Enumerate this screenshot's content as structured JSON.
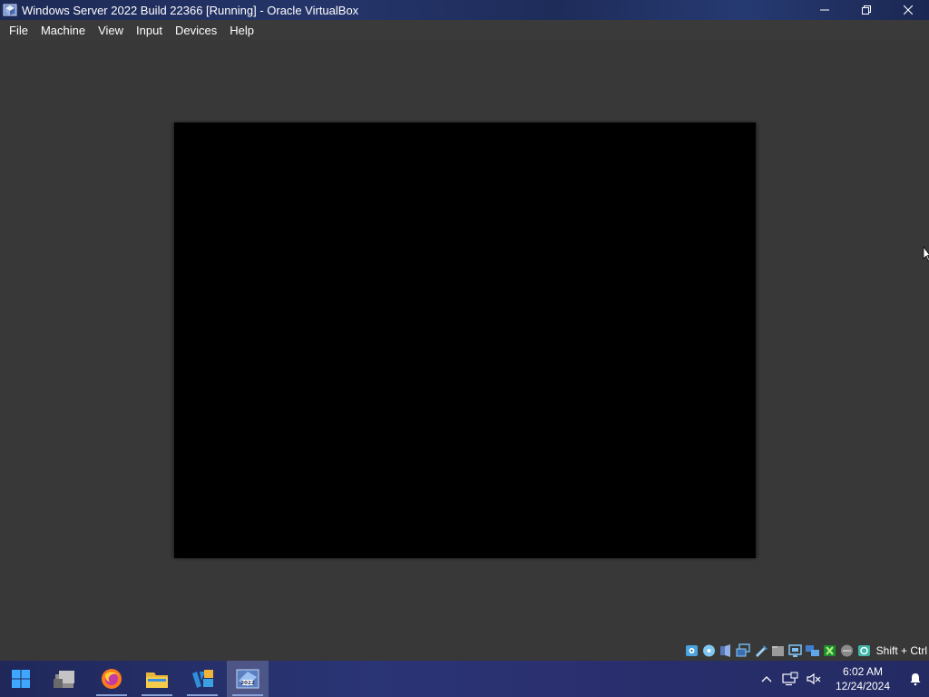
{
  "window": {
    "title": "Windows Server 2022 Build 22366 [Running] - Oracle VirtualBox",
    "controls": [
      "minimize",
      "restore",
      "close"
    ]
  },
  "menu": {
    "items": [
      "File",
      "Machine",
      "View",
      "Input",
      "Devices",
      "Help"
    ]
  },
  "status_bar": {
    "icons": [
      "hard-disk-icon",
      "optical-drive-icon",
      "audio-icon",
      "network-icon",
      "usb-icon",
      "shared-folders-icon",
      "display-icon",
      "video-capture-icon",
      "mouse-integration-icon",
      "keyboard-icon",
      "guest-additions-icon"
    ],
    "host_key": "Shift + Ctrl"
  },
  "taskbar": {
    "apps": [
      {
        "name": "start-button"
      },
      {
        "name": "file-manager-app"
      },
      {
        "name": "firefox-app",
        "running": true
      },
      {
        "name": "file-explorer-app",
        "running": true
      },
      {
        "name": "virtualbox-manager-app",
        "running": true
      },
      {
        "name": "windows-server-2022-vm-app",
        "running": true,
        "active": true
      }
    ],
    "tray": {
      "chevron": "show-hidden-icons",
      "time": "6:02 AM",
      "date": "12/24/2024"
    }
  },
  "colors": {
    "titlebar": "#1d2a55",
    "menubar": "#3a3a3a",
    "background": "#383838",
    "guest_screen": "#000000",
    "taskbar": "#2a3576"
  }
}
